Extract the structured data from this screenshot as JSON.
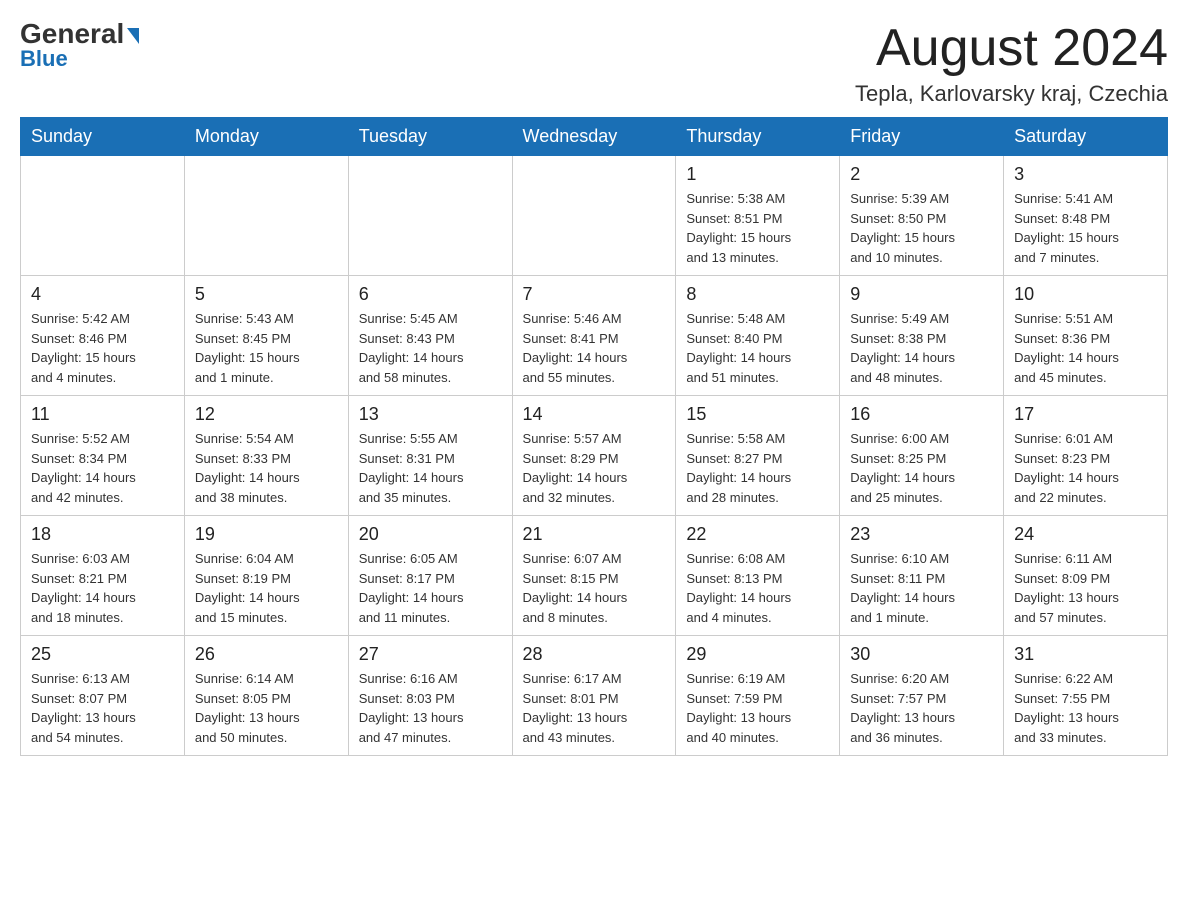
{
  "header": {
    "logo_general": "General",
    "logo_blue": "Blue",
    "month_title": "August 2024",
    "location": "Tepla, Karlovarsky kraj, Czechia"
  },
  "days_of_week": [
    "Sunday",
    "Monday",
    "Tuesday",
    "Wednesday",
    "Thursday",
    "Friday",
    "Saturday"
  ],
  "weeks": [
    [
      {
        "day": "",
        "info": ""
      },
      {
        "day": "",
        "info": ""
      },
      {
        "day": "",
        "info": ""
      },
      {
        "day": "",
        "info": ""
      },
      {
        "day": "1",
        "info": "Sunrise: 5:38 AM\nSunset: 8:51 PM\nDaylight: 15 hours\nand 13 minutes."
      },
      {
        "day": "2",
        "info": "Sunrise: 5:39 AM\nSunset: 8:50 PM\nDaylight: 15 hours\nand 10 minutes."
      },
      {
        "day": "3",
        "info": "Sunrise: 5:41 AM\nSunset: 8:48 PM\nDaylight: 15 hours\nand 7 minutes."
      }
    ],
    [
      {
        "day": "4",
        "info": "Sunrise: 5:42 AM\nSunset: 8:46 PM\nDaylight: 15 hours\nand 4 minutes."
      },
      {
        "day": "5",
        "info": "Sunrise: 5:43 AM\nSunset: 8:45 PM\nDaylight: 15 hours\nand 1 minute."
      },
      {
        "day": "6",
        "info": "Sunrise: 5:45 AM\nSunset: 8:43 PM\nDaylight: 14 hours\nand 58 minutes."
      },
      {
        "day": "7",
        "info": "Sunrise: 5:46 AM\nSunset: 8:41 PM\nDaylight: 14 hours\nand 55 minutes."
      },
      {
        "day": "8",
        "info": "Sunrise: 5:48 AM\nSunset: 8:40 PM\nDaylight: 14 hours\nand 51 minutes."
      },
      {
        "day": "9",
        "info": "Sunrise: 5:49 AM\nSunset: 8:38 PM\nDaylight: 14 hours\nand 48 minutes."
      },
      {
        "day": "10",
        "info": "Sunrise: 5:51 AM\nSunset: 8:36 PM\nDaylight: 14 hours\nand 45 minutes."
      }
    ],
    [
      {
        "day": "11",
        "info": "Sunrise: 5:52 AM\nSunset: 8:34 PM\nDaylight: 14 hours\nand 42 minutes."
      },
      {
        "day": "12",
        "info": "Sunrise: 5:54 AM\nSunset: 8:33 PM\nDaylight: 14 hours\nand 38 minutes."
      },
      {
        "day": "13",
        "info": "Sunrise: 5:55 AM\nSunset: 8:31 PM\nDaylight: 14 hours\nand 35 minutes."
      },
      {
        "day": "14",
        "info": "Sunrise: 5:57 AM\nSunset: 8:29 PM\nDaylight: 14 hours\nand 32 minutes."
      },
      {
        "day": "15",
        "info": "Sunrise: 5:58 AM\nSunset: 8:27 PM\nDaylight: 14 hours\nand 28 minutes."
      },
      {
        "day": "16",
        "info": "Sunrise: 6:00 AM\nSunset: 8:25 PM\nDaylight: 14 hours\nand 25 minutes."
      },
      {
        "day": "17",
        "info": "Sunrise: 6:01 AM\nSunset: 8:23 PM\nDaylight: 14 hours\nand 22 minutes."
      }
    ],
    [
      {
        "day": "18",
        "info": "Sunrise: 6:03 AM\nSunset: 8:21 PM\nDaylight: 14 hours\nand 18 minutes."
      },
      {
        "day": "19",
        "info": "Sunrise: 6:04 AM\nSunset: 8:19 PM\nDaylight: 14 hours\nand 15 minutes."
      },
      {
        "day": "20",
        "info": "Sunrise: 6:05 AM\nSunset: 8:17 PM\nDaylight: 14 hours\nand 11 minutes."
      },
      {
        "day": "21",
        "info": "Sunrise: 6:07 AM\nSunset: 8:15 PM\nDaylight: 14 hours\nand 8 minutes."
      },
      {
        "day": "22",
        "info": "Sunrise: 6:08 AM\nSunset: 8:13 PM\nDaylight: 14 hours\nand 4 minutes."
      },
      {
        "day": "23",
        "info": "Sunrise: 6:10 AM\nSunset: 8:11 PM\nDaylight: 14 hours\nand 1 minute."
      },
      {
        "day": "24",
        "info": "Sunrise: 6:11 AM\nSunset: 8:09 PM\nDaylight: 13 hours\nand 57 minutes."
      }
    ],
    [
      {
        "day": "25",
        "info": "Sunrise: 6:13 AM\nSunset: 8:07 PM\nDaylight: 13 hours\nand 54 minutes."
      },
      {
        "day": "26",
        "info": "Sunrise: 6:14 AM\nSunset: 8:05 PM\nDaylight: 13 hours\nand 50 minutes."
      },
      {
        "day": "27",
        "info": "Sunrise: 6:16 AM\nSunset: 8:03 PM\nDaylight: 13 hours\nand 47 minutes."
      },
      {
        "day": "28",
        "info": "Sunrise: 6:17 AM\nSunset: 8:01 PM\nDaylight: 13 hours\nand 43 minutes."
      },
      {
        "day": "29",
        "info": "Sunrise: 6:19 AM\nSunset: 7:59 PM\nDaylight: 13 hours\nand 40 minutes."
      },
      {
        "day": "30",
        "info": "Sunrise: 6:20 AM\nSunset: 7:57 PM\nDaylight: 13 hours\nand 36 minutes."
      },
      {
        "day": "31",
        "info": "Sunrise: 6:22 AM\nSunset: 7:55 PM\nDaylight: 13 hours\nand 33 minutes."
      }
    ]
  ]
}
